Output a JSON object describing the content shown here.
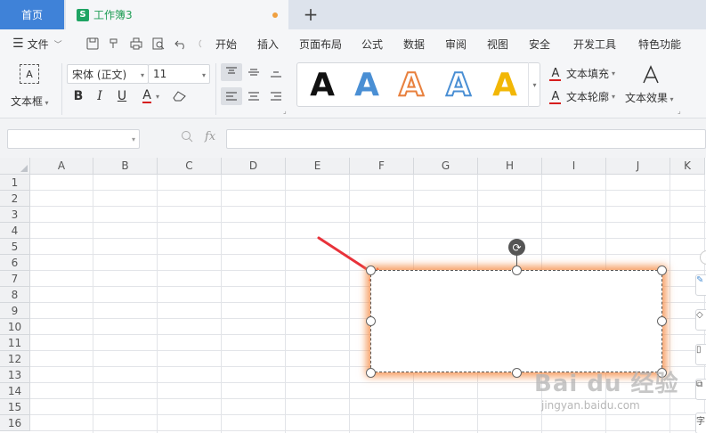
{
  "tabs": {
    "home_label": "首页",
    "doc_icon_letter": "S",
    "doc_name": "工作簿3",
    "new_tab_symbol": "+"
  },
  "menubar": {
    "file_label": "文件",
    "items": [
      "开始",
      "插入",
      "页面布局",
      "公式",
      "数据",
      "审阅",
      "视图",
      "安全",
      "开发工具",
      "特色功能"
    ]
  },
  "ribbon": {
    "textbox_icon": "A",
    "textbox_label": "文本框",
    "font_name": "宋体 (正文)",
    "font_size": "11",
    "bold_label": "B",
    "italic_label": "I",
    "underline_label": "U",
    "font_color_label": "A",
    "art_letter": "A",
    "text_fill_label": "文本填充",
    "text_outline_label": "文本轮廓",
    "text_effect_label": "文本效果"
  },
  "formula_bar": {
    "zoom_icon": "search-zoom-icon",
    "fx_label": "fx",
    "name_box_value": "",
    "formula_value": ""
  },
  "grid": {
    "columns": [
      "A",
      "B",
      "C",
      "D",
      "E",
      "F",
      "G",
      "H",
      "I",
      "J",
      "K"
    ],
    "rows": [
      "1",
      "2",
      "3",
      "4",
      "5",
      "6",
      "7",
      "8",
      "9",
      "10",
      "11",
      "12",
      "13",
      "14",
      "15",
      "16"
    ]
  },
  "watermark": {
    "logo": "Bai du 经验",
    "url": "jingyan.baidu.com"
  },
  "colors": {
    "home_tab": "#3f82d8",
    "sheet_green": "#1fa463",
    "shape_glow": "#f49250",
    "annotation_arrow": "#e8323a",
    "underline_red": "#d61e1e"
  }
}
